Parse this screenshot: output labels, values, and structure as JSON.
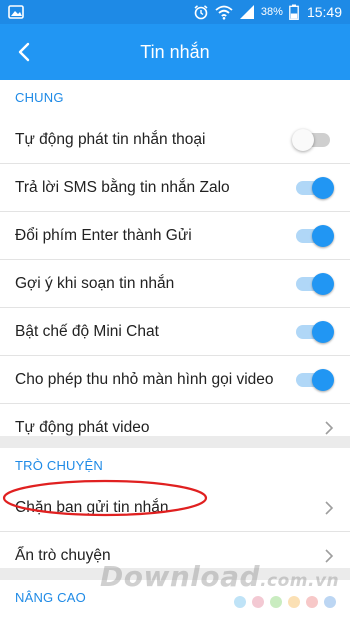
{
  "status_bar": {
    "battery_percent": "38%",
    "time": "15:49",
    "icons": [
      "gallery-icon",
      "alarm-icon",
      "wifi-icon",
      "signal-icon",
      "battery-icon"
    ]
  },
  "app_bar": {
    "title": "Tin nhắn",
    "back_icon": "back-arrow-icon"
  },
  "sections": {
    "chung": {
      "header": "CHUNG",
      "items": [
        {
          "label": "Tự động phát tin nhắn thoại",
          "toggle": false
        },
        {
          "label": "Trả lời SMS bằng tin nhắn Zalo",
          "toggle": true
        },
        {
          "label": "Đổi phím Enter thành Gửi",
          "toggle": true
        },
        {
          "label": "Gợi ý khi soạn tin nhắn",
          "toggle": true
        },
        {
          "label": "Bật chế độ Mini Chat",
          "toggle": true
        },
        {
          "label": "Cho phép thu nhỏ màn hình gọi video",
          "toggle": true
        },
        {
          "label": "Tự động phát video",
          "chevron": true
        }
      ]
    },
    "tro_chuyen": {
      "header": "TRÒ CHUYỆN",
      "items": [
        {
          "label": "Chặn bạn gửi tin nhắn",
          "chevron": true,
          "highlighted": true
        },
        {
          "label": "Ẩn trò chuyện",
          "chevron": true
        }
      ]
    },
    "nang_cao": {
      "header": "NÂNG CAO"
    }
  },
  "watermark": {
    "brand": "Download",
    "suffix": ".com.vn",
    "dot_colors": [
      "#bfe3f7",
      "#f3c9d3",
      "#c9ecc0",
      "#fbe0b4",
      "#f7c8c8",
      "#bcd6f3"
    ]
  },
  "colors": {
    "accent": "#2196f3",
    "status_bar": "#1e8ae6",
    "highlight_ring": "#e02020"
  }
}
